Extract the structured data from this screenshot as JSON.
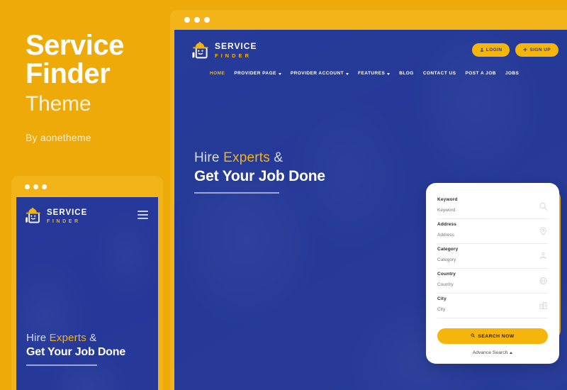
{
  "promo": {
    "title_line1": "Service",
    "title_line2": "Finder",
    "subtitle": "Theme",
    "byline": "By aonetheme"
  },
  "brand": {
    "name": "SERVICE",
    "tagline": "FINDER",
    "logo_icon": "hardhat-worker-icon",
    "accent_yellow": "#F2B418",
    "deep_blue": "#2A3E96",
    "page_background": "#EEAA08"
  },
  "window": {
    "dots": [
      "dot-red",
      "dot-yellow",
      "dot-green"
    ]
  },
  "header": {
    "auth_buttons": [
      {
        "label": "LOGIN",
        "icon": "user-icon"
      },
      {
        "label": "SIGN UP",
        "icon": "plus-icon"
      }
    ],
    "nav": [
      {
        "label": "HOME",
        "active": true,
        "dropdown": false
      },
      {
        "label": "PROVIDER PAGE",
        "active": false,
        "dropdown": true
      },
      {
        "label": "PROVIDER ACCOUNT",
        "active": false,
        "dropdown": true
      },
      {
        "label": "FEATURES",
        "active": false,
        "dropdown": true
      },
      {
        "label": "BLOG",
        "active": false,
        "dropdown": false
      },
      {
        "label": "CONTACT US",
        "active": false,
        "dropdown": false
      },
      {
        "label": "POST A JOB",
        "active": false,
        "dropdown": false
      },
      {
        "label": "JOBS",
        "active": false,
        "dropdown": false
      }
    ]
  },
  "hero": {
    "line1_plain": "Hire ",
    "line1_highlight": "Experts",
    "line1_tail": " &",
    "line2": "Get Your Job Done"
  },
  "search_panel": {
    "fields": [
      {
        "label": "Keyword",
        "value": "",
        "placeholder": "Keyword",
        "icon": "search-icon"
      },
      {
        "label": "Address",
        "value": "",
        "placeholder": "Address",
        "icon": "map-pin-icon"
      },
      {
        "label": "Category",
        "value": "",
        "placeholder": "Category",
        "icon": "category-person-icon"
      },
      {
        "label": "Country",
        "value": "",
        "placeholder": "Country",
        "icon": "globe-icon"
      },
      {
        "label": "City",
        "value": "",
        "placeholder": "City",
        "icon": "building-icon"
      }
    ],
    "search_button": {
      "label": "SEARCH NOW",
      "icon": "search-icon"
    },
    "advance_link": {
      "label": "Advance Search",
      "icon": "chevron-up-icon"
    }
  },
  "mobile": {
    "menu_icon": "hamburger-icon"
  }
}
